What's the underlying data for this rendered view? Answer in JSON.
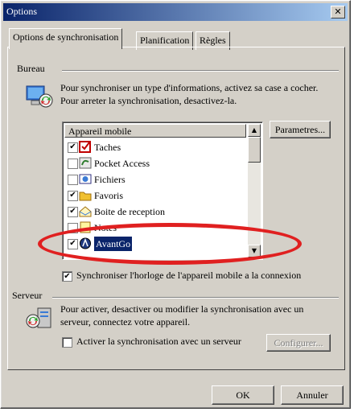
{
  "window": {
    "title": "Options",
    "close_glyph": "✕"
  },
  "tabs": [
    {
      "label": "Options de synchronisation"
    },
    {
      "label": "Planification"
    },
    {
      "label": "Règles"
    }
  ],
  "bureau": {
    "group_label": "Bureau",
    "description": "Pour synchroniser un type d'informations, activez sa case a cocher. Pour arreter la synchronisation, desactivez-la.",
    "list_header": "Appareil mobile",
    "params_button": "Parametres...",
    "items": [
      {
        "label": "Taches",
        "checked": true,
        "icon": "tasks-icon"
      },
      {
        "label": "Pocket Access",
        "checked": false,
        "icon": "pocket-access-icon"
      },
      {
        "label": "Fichiers",
        "checked": false,
        "icon": "files-icon"
      },
      {
        "label": "Favoris",
        "checked": true,
        "icon": "favorites-icon"
      },
      {
        "label": "Boite de reception",
        "checked": true,
        "icon": "inbox-icon"
      },
      {
        "label": "Notes",
        "checked": false,
        "icon": "notes-icon"
      },
      {
        "label": "AvantGo",
        "checked": true,
        "icon": "avantgo-icon",
        "selected": true
      }
    ],
    "clock_sync": {
      "label": "Synchroniser l'horloge de l'appareil mobile a la connexion",
      "checked": true
    }
  },
  "serveur": {
    "group_label": "Serveur",
    "description": "Pour activer, desactiver ou modifier la synchronisation avec un serveur, connectez votre appareil.",
    "enable_label": "Activer la synchronisation avec un serveur",
    "enable_checked": false,
    "configure_button": "Configurer..."
  },
  "footer": {
    "ok": "OK",
    "cancel": "Annuler"
  },
  "annotation": {
    "color": "#e02020"
  },
  "check_glyph": "✔"
}
